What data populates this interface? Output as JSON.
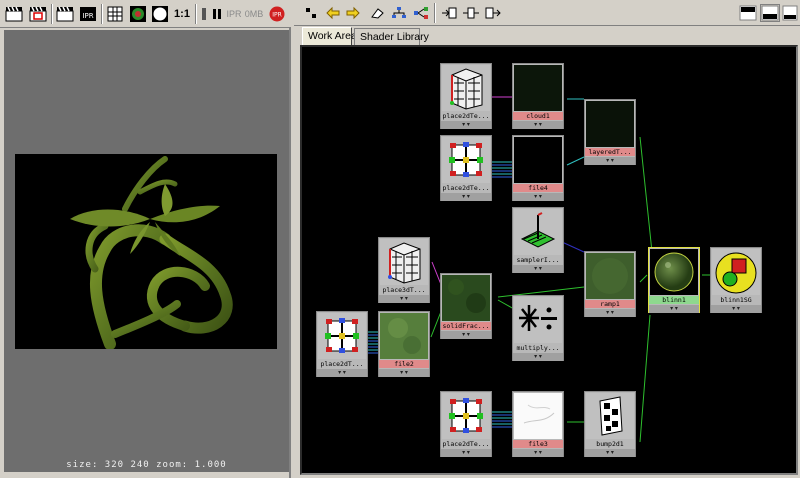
{
  "render_view": {
    "toolbar": {
      "render_icon": "clapper-icon",
      "render_region_icon": "clapper-red-icon",
      "snapshot_icon": "clapper-icon",
      "ipr_icon": "ipr-icon",
      "ratio_label": "1:1",
      "pause_icon": "pause-icon",
      "ipr_badge": "IPR",
      "mem_label": "0MB",
      "ipr_stop_icon": "ipr-red-icon"
    },
    "status": "size:  320  240 zoom: 1.000"
  },
  "hypershade": {
    "tabs": [
      {
        "label": "Work Area",
        "active": true
      },
      {
        "label": "Shader Library",
        "active": false
      }
    ],
    "nodes": {
      "n1": {
        "label": "place2dTe...",
        "kind": "place2d"
      },
      "n2": {
        "label": "cloud1",
        "kind": "texture"
      },
      "n3": {
        "label": "layeredT...",
        "kind": "texture"
      },
      "n4": {
        "label": "place2dTe...",
        "kind": "place2d"
      },
      "n5": {
        "label": "file4",
        "kind": "texture"
      },
      "n6": {
        "label": "samplerI...",
        "kind": "util"
      },
      "n7": {
        "label": "place3dT...",
        "kind": "place3d"
      },
      "n8": {
        "label": "solidFrac...",
        "kind": "texture"
      },
      "n9": {
        "label": "ramp1",
        "kind": "texture"
      },
      "n10": {
        "label": "blinn1",
        "kind": "shader"
      },
      "n11": {
        "label": "blinn1SG",
        "kind": "sg"
      },
      "n12": {
        "label": "place2dT...",
        "kind": "place2d"
      },
      "n13": {
        "label": "file2",
        "kind": "texture"
      },
      "n14": {
        "label": "multiply...",
        "kind": "util"
      },
      "n15": {
        "label": "place2dTe...",
        "kind": "place2d"
      },
      "n16": {
        "label": "file3",
        "kind": "texture"
      },
      "n17": {
        "label": "bump2d1",
        "kind": "util"
      }
    },
    "node_arrow": "▾ ▾",
    "colors": {
      "texture_label": "#e08a8a",
      "shader_label": "#8ed88e",
      "background": "#000000",
      "connection_green": "#2ec02e"
    }
  }
}
